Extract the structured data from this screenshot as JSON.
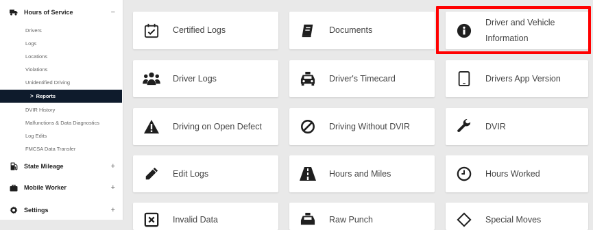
{
  "sidebar": {
    "sections": [
      {
        "label": "Hours of Service",
        "toggle": "−",
        "icon": "truck-icon"
      },
      {
        "label": "State Mileage",
        "toggle": "+",
        "icon": "gas-pump-icon"
      },
      {
        "label": "Mobile Worker",
        "toggle": "+",
        "icon": "briefcase-icon"
      },
      {
        "label": "Settings",
        "toggle": "+",
        "icon": "gear-icon"
      }
    ],
    "hos_items": [
      {
        "label": "Drivers"
      },
      {
        "label": "Logs"
      },
      {
        "label": "Locations"
      },
      {
        "label": "Violations"
      },
      {
        "label": "Unidentified Driving"
      },
      {
        "label": "Reports",
        "active": true
      },
      {
        "label": "DVIR History"
      },
      {
        "label": "Malfunctions & Data Diagnostics"
      },
      {
        "label": "Log Edits"
      },
      {
        "label": "FMCSA Data Transfer"
      }
    ],
    "active_caret": ">"
  },
  "tiles": [
    {
      "label": "Certified Logs",
      "icon": "calendar-check-icon"
    },
    {
      "label": "Documents",
      "icon": "book-icon"
    },
    {
      "label": "Driver and Vehicle Information",
      "icon": "info-circle-icon"
    },
    {
      "label": "Driver Logs",
      "icon": "users-icon"
    },
    {
      "label": "Driver's Timecard",
      "icon": "taxi-icon"
    },
    {
      "label": "Drivers App Version",
      "icon": "tablet-icon"
    },
    {
      "label": "Driving on Open Defect",
      "icon": "warning-icon"
    },
    {
      "label": "Driving Without DVIR",
      "icon": "ban-icon"
    },
    {
      "label": "DVIR",
      "icon": "wrench-icon"
    },
    {
      "label": "Edit Logs",
      "icon": "pencil-icon"
    },
    {
      "label": "Hours and Miles",
      "icon": "road-icon"
    },
    {
      "label": "Hours Worked",
      "icon": "clock-icon"
    },
    {
      "label": "Invalid Data",
      "icon": "x-square-icon"
    },
    {
      "label": "Raw Punch",
      "icon": "taxi-icon"
    },
    {
      "label": "Special Moves",
      "icon": "diamond-icon"
    }
  ],
  "colors": {
    "active_bg": "#0e1b2c",
    "highlight": "#ff0000",
    "icon": "#1f1f1f"
  }
}
